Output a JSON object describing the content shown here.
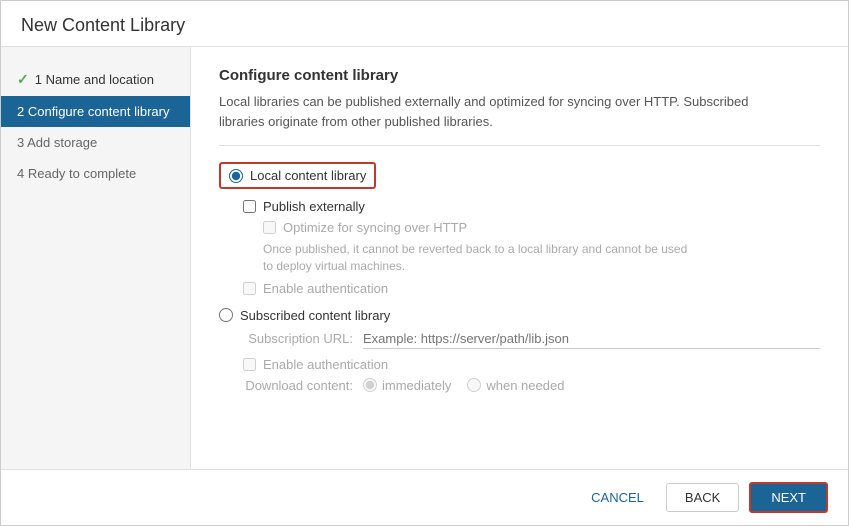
{
  "dialog": {
    "title": "New Content Library"
  },
  "sidebar": {
    "items": [
      {
        "id": "step1",
        "label": "1 Name and location",
        "state": "completed"
      },
      {
        "id": "step2",
        "label": "2 Configure content library",
        "state": "active"
      },
      {
        "id": "step3",
        "label": "3 Add storage",
        "state": "default"
      },
      {
        "id": "step4",
        "label": "4 Ready to complete",
        "state": "default"
      }
    ]
  },
  "main": {
    "section_title": "Configure content library",
    "section_desc_line1": "Local libraries can be published externally and optimized for syncing over HTTP. Subscribed",
    "section_desc_line2": "libraries originate from other published libraries.",
    "local_library_label": "Local content library",
    "publish_externally_label": "Publish externally",
    "optimize_http_label": "Optimize for syncing over HTTP",
    "optimize_desc_line1": "Once published, it cannot be reverted back to a local library and cannot be used",
    "optimize_desc_line2": "to deploy virtual machines.",
    "enable_auth_local_label": "Enable authentication",
    "subscribed_library_label": "Subscribed content library",
    "subscription_url_label": "Subscription URL:",
    "subscription_url_placeholder": "Example: https://server/path/lib.json",
    "enable_auth_sub_label": "Enable authentication",
    "download_content_label": "Download content:",
    "immediately_label": "immediately",
    "when_needed_label": "when needed"
  },
  "footer": {
    "cancel_label": "CANCEL",
    "back_label": "BACK",
    "next_label": "NEXT"
  },
  "colors": {
    "active_step_bg": "#1a6496",
    "next_btn_bg": "#1a6496",
    "highlight_border": "#c0392b",
    "check_color": "#4caf50",
    "link_color": "#1a6496"
  }
}
